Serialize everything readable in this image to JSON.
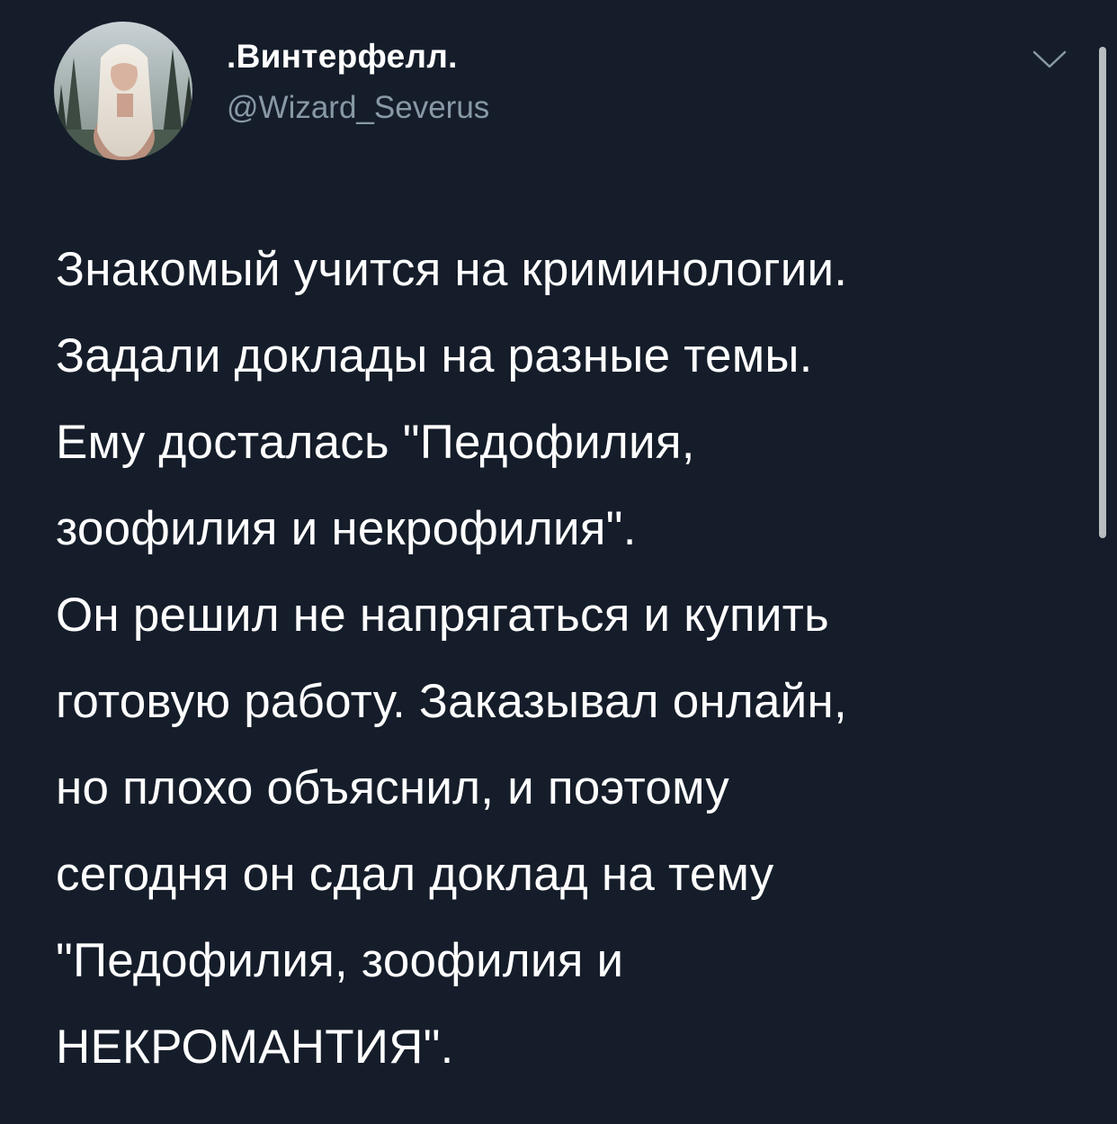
{
  "author": {
    "display_name": ".Винтерфелл.",
    "handle": "@Wizard_Severus",
    "avatar_icon": "profile-photo"
  },
  "menu_icon": "chevron-down-icon",
  "tweet": {
    "lines": [
      "Знакомый учится на криминологии.",
      "Задали доклады на разные темы.",
      "Ему досталась \"Педофилия,",
      "зоофилия и некрофилия\".",
      "Он решил не напрягаться и купить",
      "готовую работу. Заказывал онлайн,",
      "но плохо объяснил, и поэтому",
      "сегодня он сдал доклад на тему",
      "\"Педофилия, зоофилия и",
      "НЕКРОМАНТИЯ\"."
    ]
  },
  "colors": {
    "background": "#151d2a",
    "text": "#ffffff",
    "secondary_text": "#8899a6",
    "scrollbar": "#b9bcc0"
  }
}
